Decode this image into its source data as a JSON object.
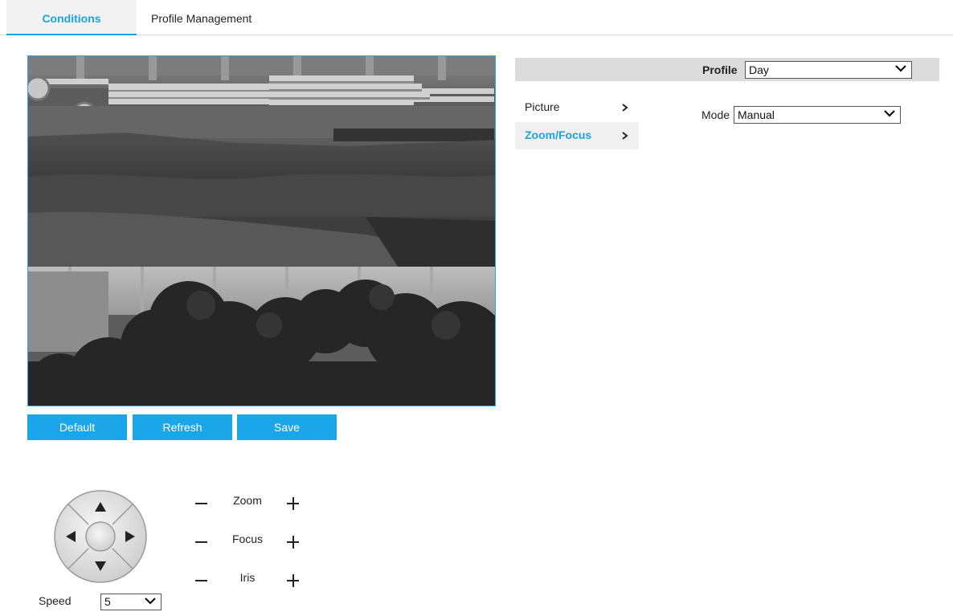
{
  "tabs": [
    {
      "label": "Conditions",
      "active": true
    },
    {
      "label": "Profile Management",
      "active": false
    }
  ],
  "buttons": {
    "default_label": "Default",
    "refresh_label": "Refresh",
    "save_label": "Save"
  },
  "ptz": {
    "controls": [
      {
        "label": "Zoom"
      },
      {
        "label": "Focus"
      },
      {
        "label": "Iris"
      }
    ],
    "speed_label": "Speed",
    "speed_value": "5"
  },
  "settings": {
    "profile_label": "Profile",
    "profile_value": "Day",
    "menu": [
      {
        "label": "Picture"
      },
      {
        "label": "Zoom/Focus"
      }
    ],
    "mode_label": "Mode",
    "mode_value": "Manual"
  },
  "colors": {
    "accent": "#1ba1e2",
    "button": "#1ba6ea",
    "header_bar": "#dcdcdc"
  }
}
